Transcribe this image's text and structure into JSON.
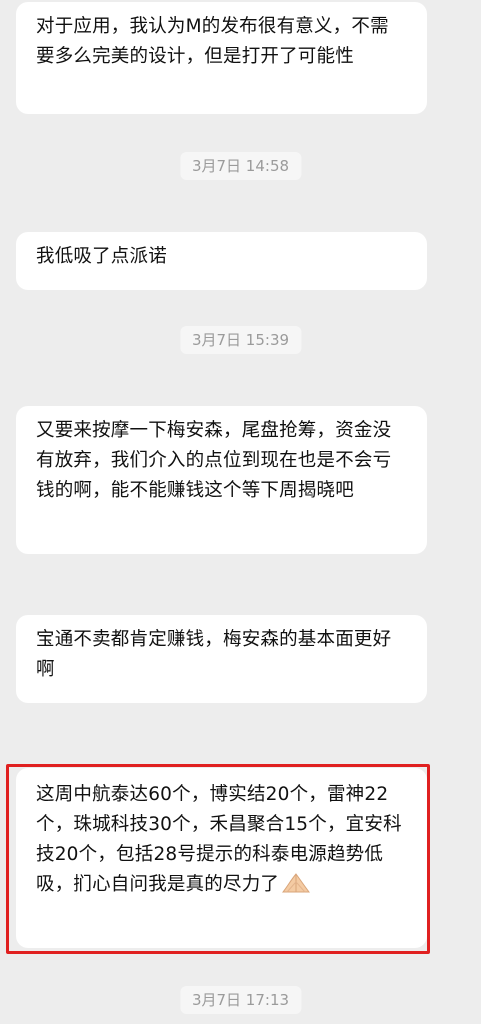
{
  "messages": [
    {
      "type": "bubble",
      "text": "对于应用，我认为M的发布很有意义，不需要多么完美的设计，但是打开了可能性"
    },
    {
      "type": "timestamp",
      "text": "3月7日 14:58"
    },
    {
      "type": "bubble",
      "text": "我低吸了点派诺"
    },
    {
      "type": "timestamp",
      "text": "3月7日 15:39"
    },
    {
      "type": "bubble",
      "text": "又要来按摩一下梅安森，尾盘抢筹，资金没有放弃，我们介入的点位到现在也是不会亏钱的啊，能不能赚钱这个等下周揭晓吧"
    },
    {
      "type": "bubble",
      "text": "宝通不卖都肯定赚钱，梅安森的基本面更好啊"
    },
    {
      "type": "bubble",
      "text": "这周中航泰达60个，博实结20个，雷神22个，珠城科技30个，禾昌聚合15个，宜安科技20个，包括28号提示的科泰电源趋势低吸，扪心自问我是真的尽力了",
      "emoji": "praying-hands",
      "highlighted": true
    },
    {
      "type": "timestamp",
      "text": "3月7日 17:13"
    }
  ],
  "colors": {
    "background": "#ededed",
    "bubble": "#ffffff",
    "timestamp_text": "#9b9b9b",
    "highlight_border": "#e02020"
  }
}
